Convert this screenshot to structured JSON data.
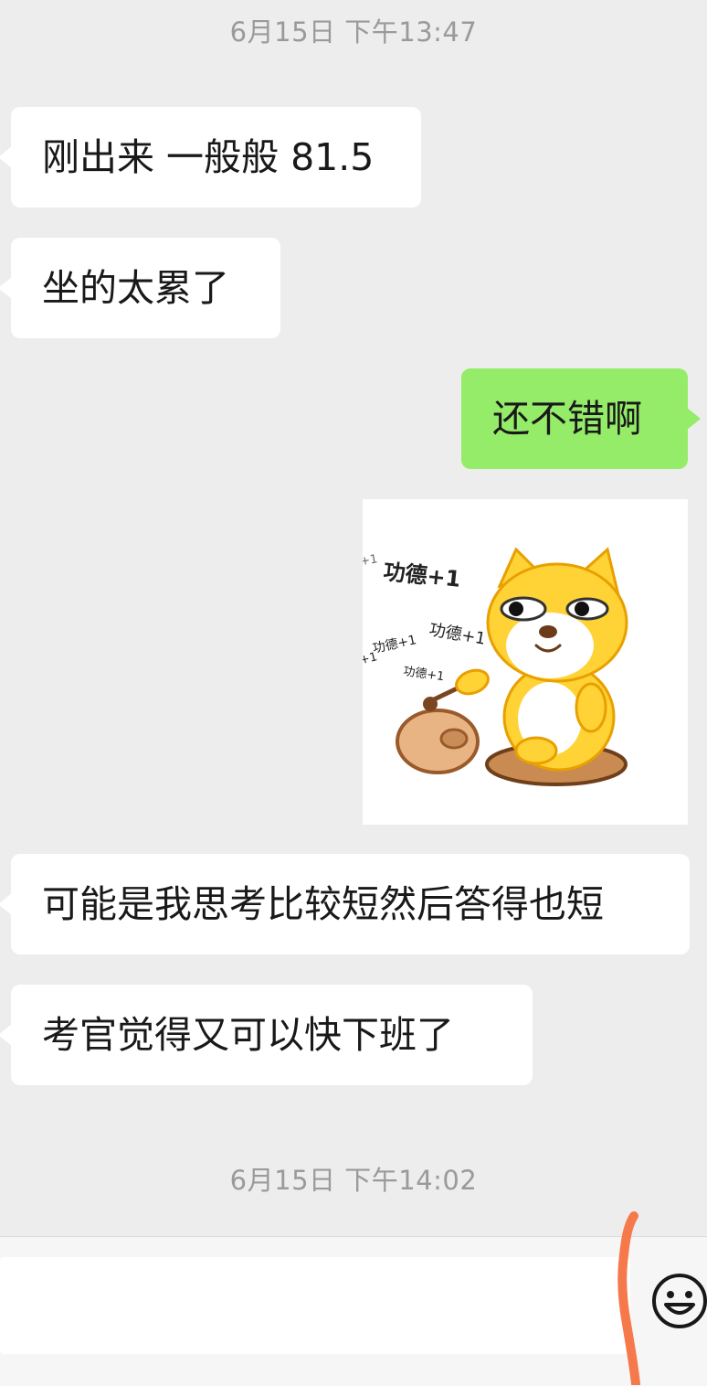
{
  "chat": {
    "timestamp_1": "6月15日 下午13:47",
    "timestamp_2": "6月15日 下午14:02",
    "messages": [
      {
        "side": "left",
        "text": "刚出来 一般般 81.5"
      },
      {
        "side": "left",
        "text": "坐的太累了"
      },
      {
        "side": "right",
        "text": "还不错啊"
      },
      {
        "side": "right",
        "type": "sticker",
        "sticker_texts": [
          "功德+1",
          "功德+1",
          "功德+1",
          "功德+1",
          "功德+1",
          "+1",
          "+1"
        ]
      },
      {
        "side": "left",
        "text": "可能是我思考比较短然后答得也短"
      },
      {
        "side": "left",
        "text": "考官觉得又可以快下班了"
      }
    ]
  },
  "input_bar": {
    "emoji_icon": "smiley-face-icon",
    "input_value": ""
  },
  "colors": {
    "background": "#ededed",
    "bubble_left": "#ffffff",
    "bubble_right": "#95ec69",
    "timestamp": "#9a9a9a",
    "annotation": "#f5794a"
  }
}
